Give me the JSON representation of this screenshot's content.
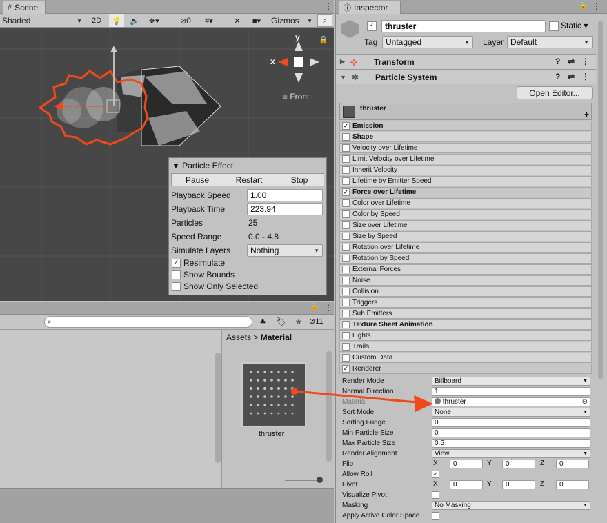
{
  "scene": {
    "tab_label": "Scene",
    "shading": "Shaded",
    "mode_2d": "2D",
    "hidden_count": "0",
    "gizmos": "Gizmos",
    "axis_x": "x",
    "axis_y": "y",
    "view_label": "Front"
  },
  "particle_effect": {
    "title": "Particle Effect",
    "pause": "Pause",
    "restart": "Restart",
    "stop": "Stop",
    "rows": [
      {
        "label": "Playback Speed",
        "value": "1.00"
      },
      {
        "label": "Playback Time",
        "value": "223.94"
      },
      {
        "label": "Particles",
        "value": "25"
      },
      {
        "label": "Speed Range",
        "value": "0.0 - 4.8"
      },
      {
        "label": "Simulate Layers",
        "value": "Nothing"
      }
    ],
    "checks": [
      {
        "label": "Resimulate",
        "checked": true
      },
      {
        "label": "Show Bounds",
        "checked": false
      },
      {
        "label": "Show Only Selected",
        "checked": false
      }
    ]
  },
  "project": {
    "search_placeholder": "",
    "hidden_count": "11",
    "breadcrumb_root": "Assets",
    "breadcrumb_sep": ">",
    "breadcrumb_current": "Material",
    "asset_name": "thruster"
  },
  "inspector": {
    "tab_label": "Inspector",
    "object_name": "thruster",
    "static_label": "Static",
    "tag_label": "Tag",
    "tag_value": "Untagged",
    "layer_label": "Layer",
    "layer_value": "Default",
    "transform_label": "Transform",
    "particle_system_label": "Particle System",
    "open_editor": "Open Editor...",
    "system_name": "thruster",
    "modules": [
      {
        "label": "Emission",
        "checked": true,
        "bold": true
      },
      {
        "label": "Shape",
        "checked": false,
        "bold": true
      },
      {
        "label": "Velocity over Lifetime",
        "checked": false,
        "bold": false
      },
      {
        "label": "Limit Velocity over Lifetime",
        "checked": false,
        "bold": false
      },
      {
        "label": "Inherit Velocity",
        "checked": false,
        "bold": false
      },
      {
        "label": "Lifetime by Emitter Speed",
        "checked": false,
        "bold": false
      },
      {
        "label": "Force over Lifetime",
        "checked": true,
        "bold": true
      },
      {
        "label": "Color over Lifetime",
        "checked": false,
        "bold": false
      },
      {
        "label": "Color by Speed",
        "checked": false,
        "bold": false
      },
      {
        "label": "Size over Lifetime",
        "checked": false,
        "bold": false
      },
      {
        "label": "Size by Speed",
        "checked": false,
        "bold": false
      },
      {
        "label": "Rotation over Lifetime",
        "checked": false,
        "bold": false
      },
      {
        "label": "Rotation by Speed",
        "checked": false,
        "bold": false
      },
      {
        "label": "External Forces",
        "checked": false,
        "bold": false
      },
      {
        "label": "Noise",
        "checked": false,
        "bold": false
      },
      {
        "label": "Collision",
        "checked": false,
        "bold": false
      },
      {
        "label": "Triggers",
        "checked": false,
        "bold": false
      },
      {
        "label": "Sub Emitters",
        "checked": false,
        "bold": false
      },
      {
        "label": "Texture Sheet Animation",
        "checked": false,
        "bold": true
      },
      {
        "label": "Lights",
        "checked": false,
        "bold": false
      },
      {
        "label": "Trails",
        "checked": false,
        "bold": false
      },
      {
        "label": "Custom Data",
        "checked": false,
        "bold": false
      },
      {
        "label": "Renderer",
        "checked": true,
        "bold": false
      }
    ],
    "renderer": {
      "render_mode_label": "Render Mode",
      "render_mode": "Billboard",
      "normal_direction_label": "Normal Direction",
      "normal_direction": "1",
      "material_label": "Material",
      "material": "thruster",
      "sort_mode_label": "Sort Mode",
      "sort_mode": "None",
      "sorting_fudge_label": "Sorting Fudge",
      "sorting_fudge": "0",
      "min_size_label": "Min Particle Size",
      "min_size": "0",
      "max_size_label": "Max Particle Size",
      "max_size": "0.5",
      "alignment_label": "Render Alignment",
      "alignment": "View",
      "flip_label": "Flip",
      "flip_x": "0",
      "flip_y": "0",
      "flip_z": "0",
      "allow_roll_label": "Allow Roll",
      "allow_roll": true,
      "pivot_label": "Pivot",
      "pivot_x": "0",
      "pivot_y": "0",
      "pivot_z": "0",
      "visualize_pivot_label": "Visualize Pivot",
      "visualize_pivot": false,
      "masking_label": "Masking",
      "masking": "No Masking",
      "active_color_label": "Apply Active Color Space",
      "active_color": false,
      "axis_x": "X",
      "axis_y": "Y",
      "axis_z": "Z"
    }
  },
  "colors": {
    "annotation": "#f04a1a",
    "scene_bg": "#474747",
    "panel_bg": "#c2c2c2",
    "header_bg": "#a5a5a5"
  }
}
